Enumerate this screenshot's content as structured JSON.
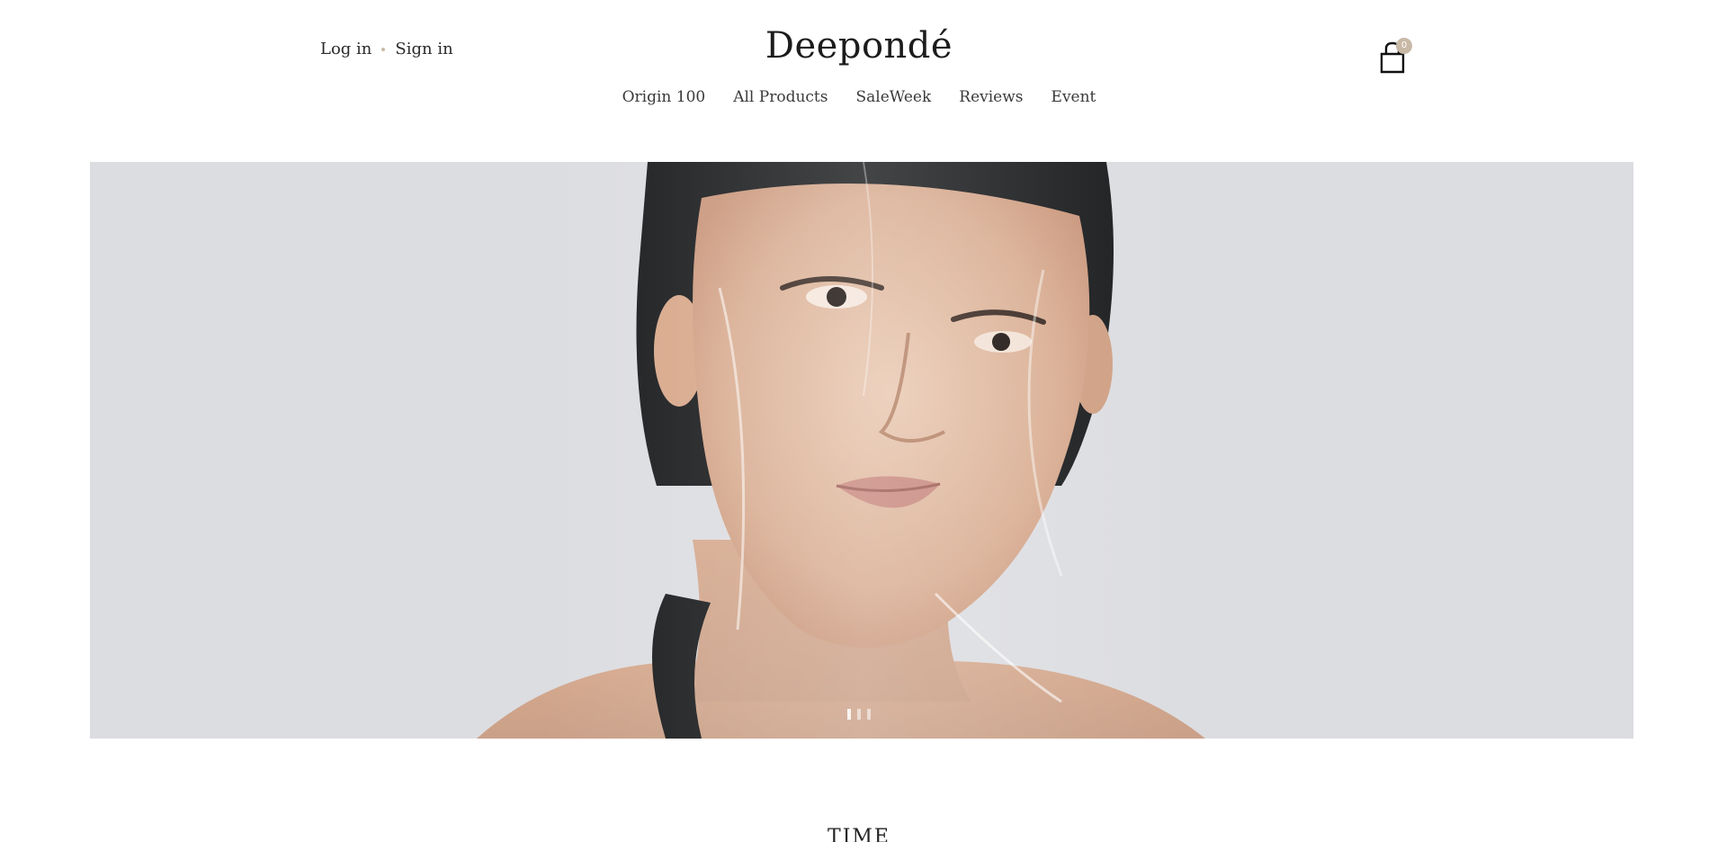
{
  "header": {
    "auth": {
      "login_label": "Log in",
      "signin_label": "Sign in"
    },
    "logo": "Deepondé",
    "nav": [
      {
        "label": "Origin 100"
      },
      {
        "label": "All Products"
      },
      {
        "label": "SaleWeek"
      },
      {
        "label": "Reviews"
      },
      {
        "label": "Event"
      }
    ],
    "cart": {
      "icon": "shopping-bag-icon",
      "count": "0"
    }
  },
  "hero": {
    "slide_count": 3,
    "active_slide": 1
  },
  "section": {
    "title": "TIME"
  },
  "colors": {
    "hero_background": "#dcdde1",
    "badge": "#c8b8a6",
    "text": "#222222"
  }
}
